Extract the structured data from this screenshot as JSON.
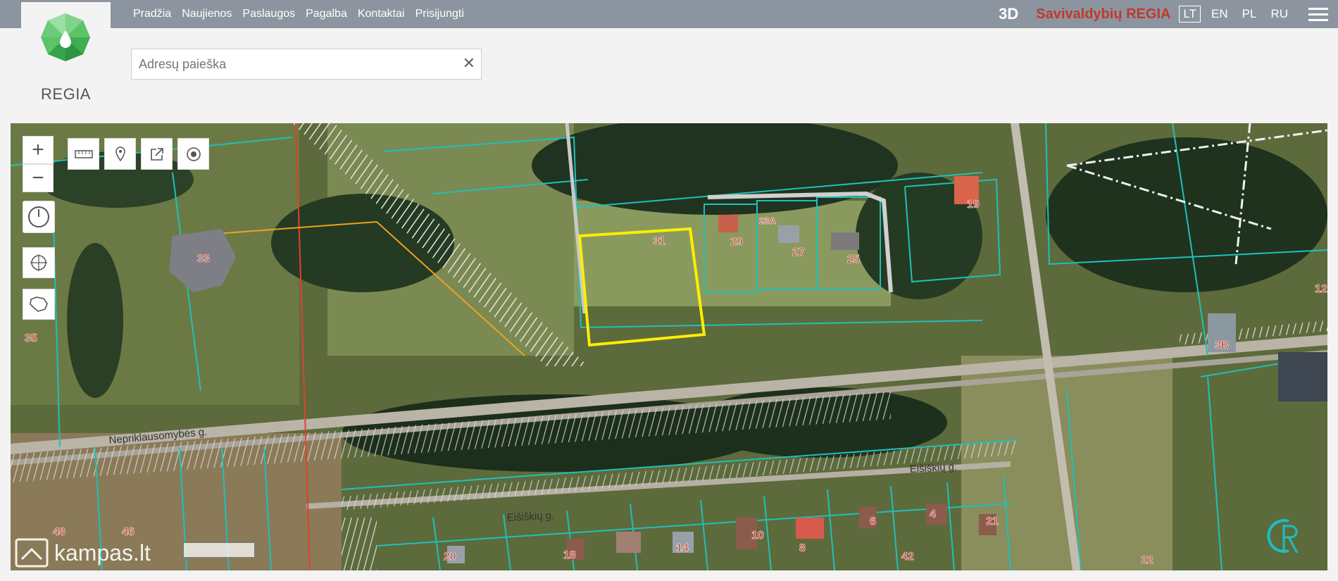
{
  "nav": [
    "Pradžia",
    "Naujienos",
    "Paslaugos",
    "Pagalba",
    "Kontaktai",
    "Prisijungti"
  ],
  "header": {
    "logo_text": "REGIA",
    "btn_3d": "3D",
    "brand": "Savivaldybių REGIA",
    "languages": [
      "LT",
      "EN",
      "PL",
      "RU"
    ],
    "active_language": "LT"
  },
  "search": {
    "placeholder": "Adresų paieška",
    "value": ""
  },
  "map": {
    "roads": [
      "Nepriklausomybės g.",
      "Eišiškių g.",
      "Eišiškių g."
    ],
    "parcel_numbers": [
      "31",
      "29",
      "27",
      "25",
      "19",
      "33",
      "35",
      "3B",
      "48",
      "46",
      "20",
      "18",
      "14",
      "10",
      "8",
      "6",
      "4",
      "21",
      "42",
      "22",
      "12",
      "23A"
    ],
    "selected_parcel": "31"
  },
  "watermark": "kampas.lt",
  "colors": {
    "topbar": "#8c959f",
    "brand": "#c0392b",
    "parcel_line": "#1fb8b0",
    "selection": "#ffee00"
  }
}
